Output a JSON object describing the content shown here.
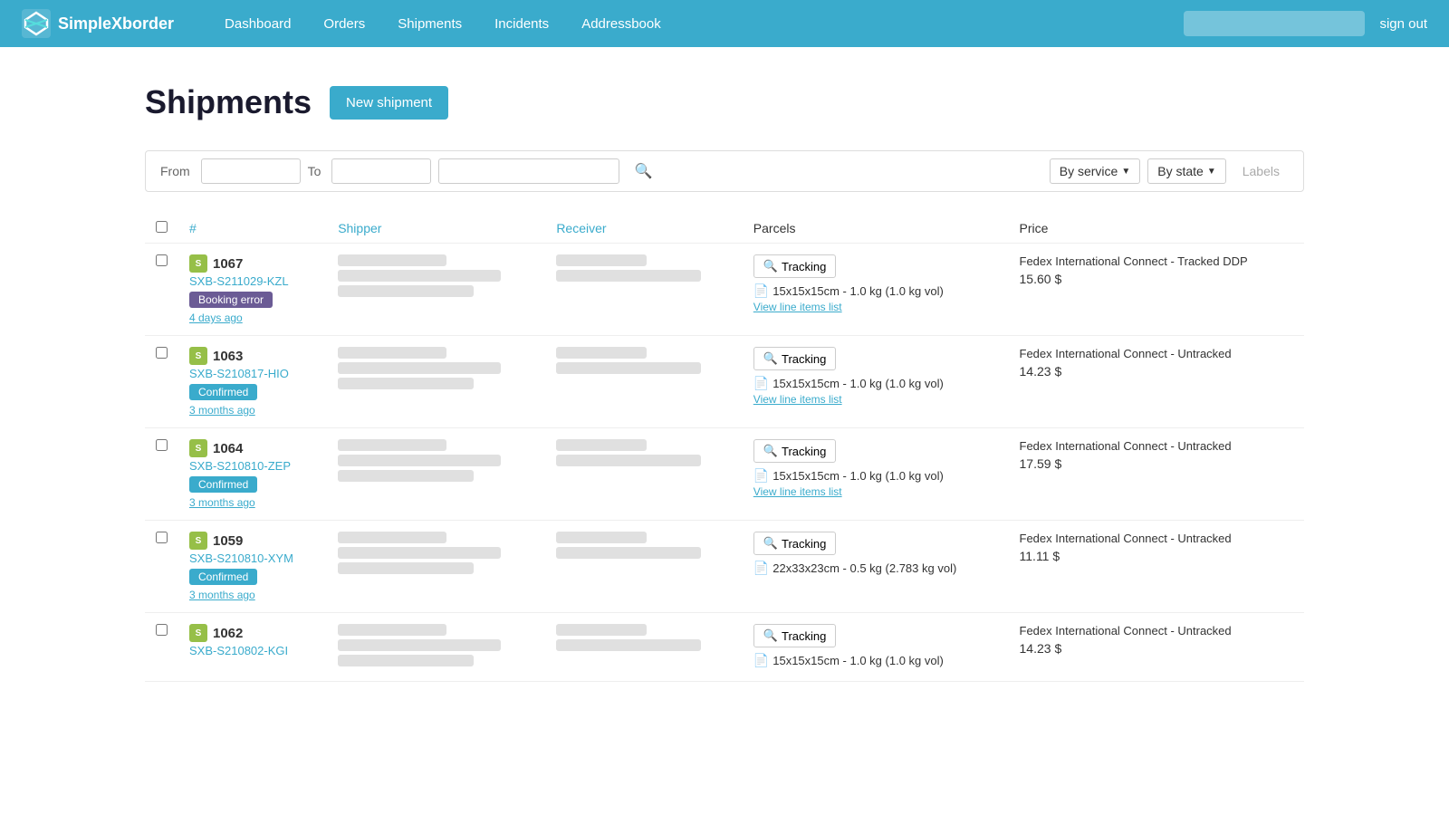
{
  "app": {
    "name": "SimpleXborder",
    "logo_text": "SimpleXborder"
  },
  "nav": {
    "items": [
      {
        "label": "Dashboard",
        "id": "dashboard"
      },
      {
        "label": "Orders",
        "id": "orders"
      },
      {
        "label": "Shipments",
        "id": "shipments"
      },
      {
        "label": "Incidents",
        "id": "incidents"
      },
      {
        "label": "Addressbook",
        "id": "addressbook"
      }
    ],
    "sign_out": "sign out"
  },
  "page": {
    "title": "Shipments",
    "new_shipment_btn": "New shipment"
  },
  "filters": {
    "from_label": "From",
    "to_label": "To",
    "from_value": "",
    "to_value": "",
    "search_placeholder": "",
    "by_service_label": "By service",
    "by_state_label": "By state",
    "labels_btn": "Labels"
  },
  "table": {
    "headers": [
      "#",
      "Shipper",
      "Receiver",
      "Parcels",
      "Price"
    ],
    "rows": [
      {
        "id": "1067",
        "ref": "SXB-S211029-KZL",
        "badge": "Booking error",
        "badge_type": "error",
        "time": "4 days ago",
        "tracking_label": "Tracking",
        "parcel_dims": "15x15x15cm - 1.0 kg (1.0 kg vol)",
        "view_items": "View line items list",
        "service": "Fedex International Connect - Tracked DDP",
        "price": "15.60 $"
      },
      {
        "id": "1063",
        "ref": "SXB-S210817-HIO",
        "badge": "Confirmed",
        "badge_type": "confirmed",
        "time": "3 months ago",
        "tracking_label": "Tracking",
        "parcel_dims": "15x15x15cm - 1.0 kg (1.0 kg vol)",
        "view_items": "View line items list",
        "service": "Fedex International Connect - Untracked",
        "price": "14.23 $"
      },
      {
        "id": "1064",
        "ref": "SXB-S210810-ZEP",
        "badge": "Confirmed",
        "badge_type": "confirmed",
        "time": "3 months ago",
        "tracking_label": "Tracking",
        "parcel_dims": "15x15x15cm - 1.0 kg (1.0 kg vol)",
        "view_items": "View line items list",
        "service": "Fedex International Connect - Untracked",
        "price": "17.59 $"
      },
      {
        "id": "1059",
        "ref": "SXB-S210810-XYM",
        "badge": "Confirmed",
        "badge_type": "confirmed",
        "time": "3 months ago",
        "tracking_label": "Tracking",
        "parcel_dims": "22x33x23cm - 0.5 kg (2.783 kg vol)",
        "view_items": "",
        "service": "Fedex International Connect - Untracked",
        "price": "11.11 $"
      },
      {
        "id": "1062",
        "ref": "SXB-S210802-KGI",
        "badge": "",
        "badge_type": "",
        "time": "",
        "tracking_label": "Tracking",
        "parcel_dims": "15x15x15cm - 1.0 kg (1.0 kg vol)",
        "view_items": "",
        "service": "Fedex International Connect - Untracked",
        "price": "14.23 $"
      }
    ]
  }
}
